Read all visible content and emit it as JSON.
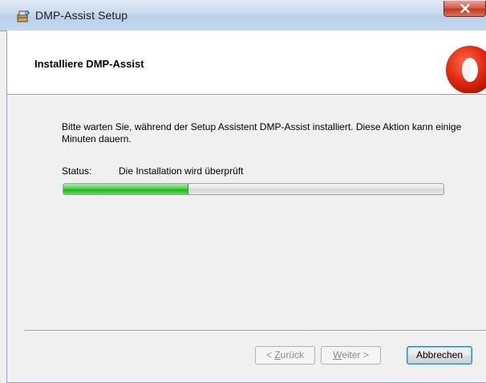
{
  "window": {
    "title": "DMP-Assist Setup",
    "icons": {
      "app": "installer-package-icon",
      "close": "close-icon",
      "logo": "dmp-assist-logo-icon"
    },
    "colors": {
      "close_button": "#c4391f",
      "progress_fill": "#1fb51f",
      "logo_red": "#e0260e",
      "default_button_border": "#3c7fb1"
    }
  },
  "header": {
    "title": "Installiere DMP-Assist"
  },
  "body": {
    "message": "Bitte warten Sie, während der Setup Assistent DMP-Assist installiert. Diese Aktion kann einige Minuten dauern.",
    "status_label": "Status:",
    "status_value": "Die Installation wird überprüft",
    "progress_fraction": 0.33
  },
  "buttons": {
    "back_prefix": "< ",
    "back_mnemonic": "Z",
    "back_rest": "urück",
    "next_mnemonic": "W",
    "next_rest": "eiter >",
    "cancel": "Abbrechen"
  }
}
